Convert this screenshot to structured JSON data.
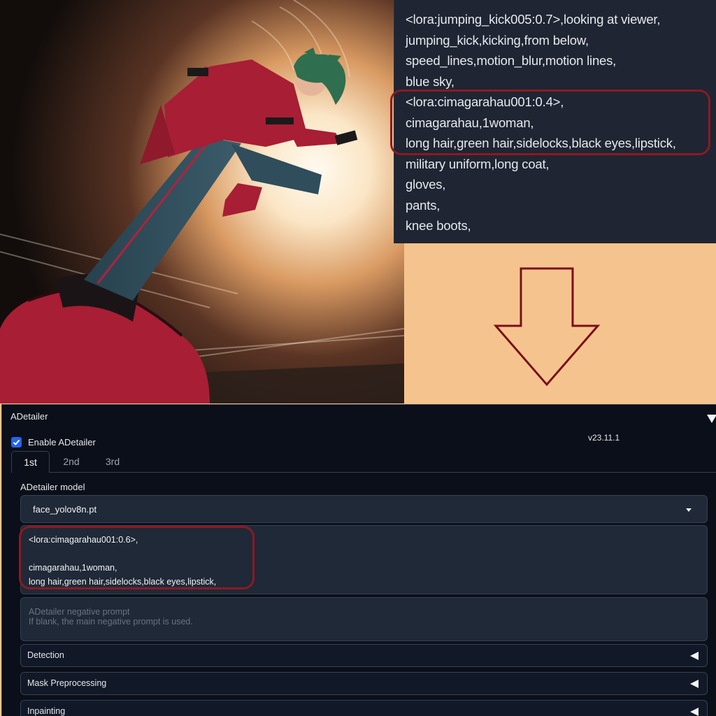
{
  "prompt_panel": {
    "lines": [
      "<lora:jumping_kick005:0.7>,looking at viewer,",
      "jumping_kick,kicking,from below,",
      "speed_lines,motion_blur,motion lines,",
      "blue sky,",
      "<lora:cimagarahau001:0.4>,",
      "cimagarahau,1woman,",
      "long hair,green hair,sidelocks,black eyes,lipstick,",
      "military uniform,long coat,",
      "gloves,",
      "pants,",
      "knee boots,"
    ]
  },
  "adetailer": {
    "title": "ADetailer",
    "enable_label": "Enable ADetailer",
    "enabled": true,
    "version": "v23.11.1",
    "tabs": [
      {
        "label": "1st",
        "active": true
      },
      {
        "label": "2nd",
        "active": false
      },
      {
        "label": "3rd",
        "active": false
      }
    ],
    "model_label": "ADetailer model",
    "model_value": "face_yolov8n.pt",
    "prompt_lines": [
      "<lora:cimagarahau001:0.6>,",
      "",
      "cimagarahau,1woman,",
      "long hair,green hair,sidelocks,black eyes,lipstick,"
    ],
    "negative_placeholder_lines": [
      "ADetailer negative prompt",
      "If blank, the main negative prompt is used."
    ],
    "sections": [
      {
        "label": "Detection"
      },
      {
        "label": "Mask Preprocessing"
      },
      {
        "label": "Inpainting"
      }
    ]
  },
  "colors": {
    "highlight": "#8b1a23",
    "background": "#f5c48e",
    "panel": "#0b0f19",
    "checkbox": "#2563eb"
  },
  "icons": [
    "down-arrow-icon",
    "check-icon",
    "dropdown-caret-icon",
    "collapse-triangle-icon",
    "expand-triangle-icon"
  ]
}
